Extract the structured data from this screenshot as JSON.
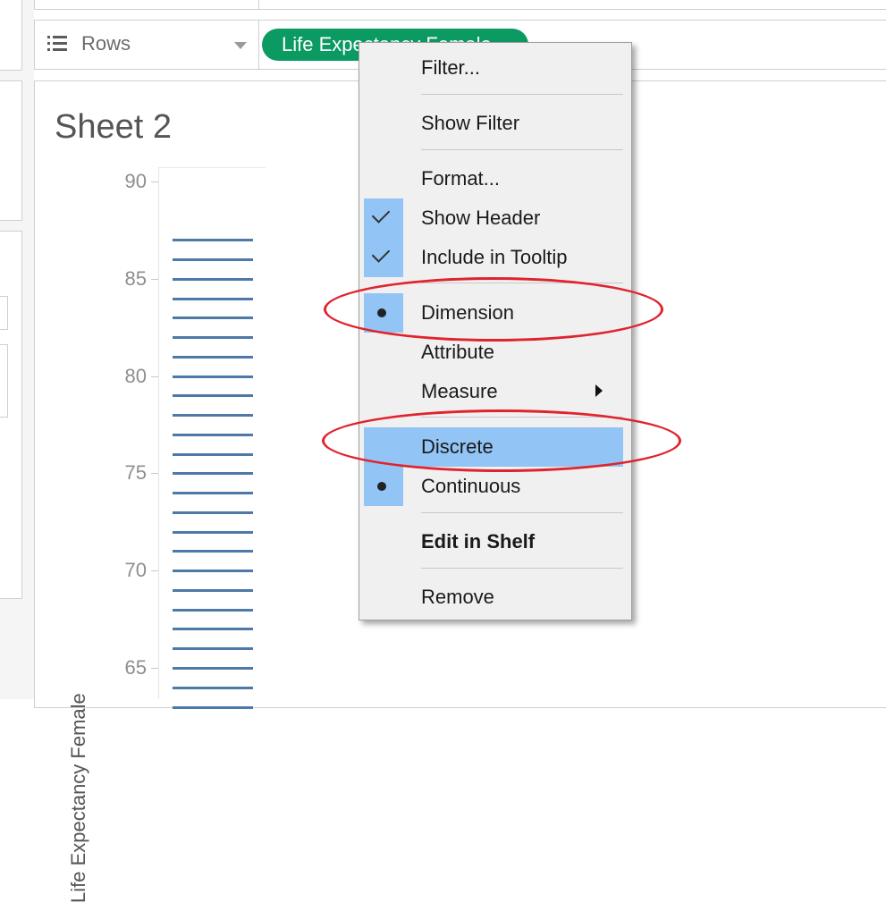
{
  "shelf": {
    "rows_label": "Rows",
    "pill_label": "Life Expectancy Female"
  },
  "sheet": {
    "title": "Sheet 2",
    "axis_title": "Life Expectancy Female",
    "tick_labels": [
      "90",
      "85",
      "80",
      "75",
      "70",
      "65"
    ]
  },
  "chart_data": {
    "type": "scatter",
    "title": "Sheet 2",
    "ylabel": "Life Expectancy Female",
    "ylim": [
      63,
      90
    ],
    "yticks": [
      90,
      85,
      80,
      75,
      70,
      65
    ],
    "mark": "dash",
    "color": "#4e79a7",
    "values": [
      87,
      86,
      85,
      84,
      83,
      82,
      81,
      80,
      79,
      78,
      77,
      76,
      75,
      74,
      73,
      72,
      71,
      70,
      69,
      68,
      67,
      66,
      65,
      64,
      63
    ]
  },
  "menu": {
    "filter": "Filter...",
    "show_filter": "Show Filter",
    "format": "Format...",
    "show_header": "Show Header",
    "include_tooltip": "Include in Tooltip",
    "dimension": "Dimension",
    "attribute": "Attribute",
    "measure": "Measure",
    "discrete": "Discrete",
    "continuous": "Continuous",
    "edit_in_shelf": "Edit in Shelf",
    "remove": "Remove"
  },
  "colors": {
    "pill": "#0c9a63",
    "highlight": "#92c4f5",
    "annotation": "#e0232e",
    "mark": "#4e79a7"
  }
}
